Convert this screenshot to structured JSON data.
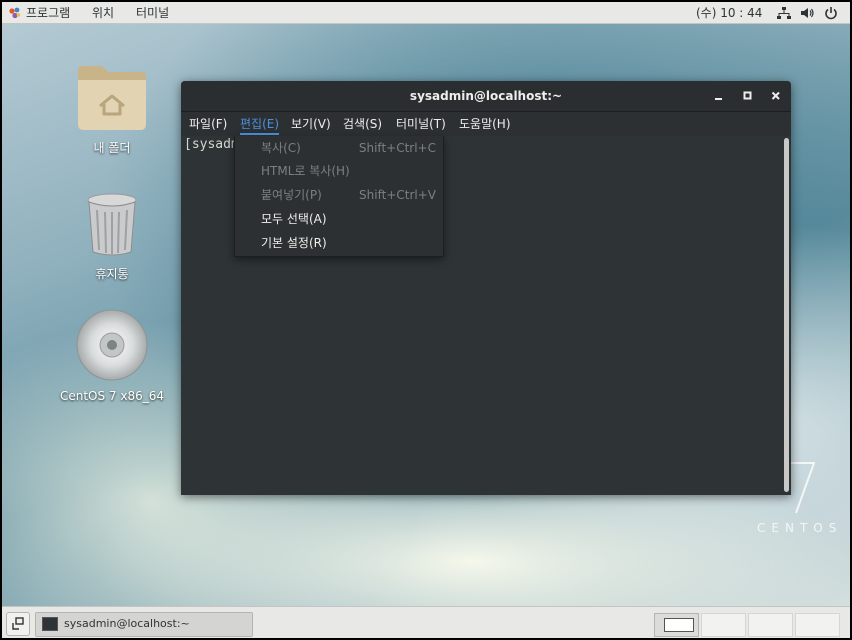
{
  "topbar": {
    "apps_label": "프로그램",
    "places_label": "위치",
    "terminal_label": "터미널",
    "clock": "(수) 10 : 44",
    "icons": [
      "network-icon",
      "volume-icon",
      "power-icon"
    ]
  },
  "desktop": {
    "icons": [
      {
        "label": "내 폴더",
        "icon": "home-folder-icon"
      },
      {
        "label": "휴지통",
        "icon": "trash-icon"
      },
      {
        "label": "CentOS 7 x86_64",
        "icon": "disc-icon"
      }
    ],
    "logo_number": "7",
    "logo_text": "CENTOS"
  },
  "terminal": {
    "title": "sysadmin@localhost:~",
    "menubar": [
      {
        "label": "파일(F)",
        "active": false
      },
      {
        "label": "편집(E)",
        "active": true
      },
      {
        "label": "보기(V)",
        "active": false
      },
      {
        "label": "검색(S)",
        "active": false
      },
      {
        "label": "터미널(T)",
        "active": false
      },
      {
        "label": "도움말(H)",
        "active": false
      }
    ],
    "prompt": "[sysadm",
    "window_buttons": [
      "minimize-icon",
      "maximize-icon",
      "close-icon"
    ]
  },
  "edit_menu": {
    "items": [
      {
        "label": "복사(C)",
        "accel": "Shift+Ctrl+C",
        "enabled": false
      },
      {
        "label": "HTML로 복사(H)",
        "accel": "",
        "enabled": false
      },
      {
        "label": "붙여넣기(P)",
        "accel": "Shift+Ctrl+V",
        "enabled": false
      },
      {
        "label": "모두 선택(A)",
        "accel": "",
        "enabled": true
      },
      {
        "label": "기본 설정(R)",
        "accel": "",
        "enabled": true
      }
    ]
  },
  "taskbar": {
    "window_label": "sysadmin@localhost:~",
    "workspaces": 4,
    "active_workspace": 1
  },
  "colors": {
    "menu_active": "#4a90d9",
    "terminal_bg": "#2e3436",
    "titlebar_bg": "#2b2e30",
    "panel_bg": "#e8e8e7"
  }
}
